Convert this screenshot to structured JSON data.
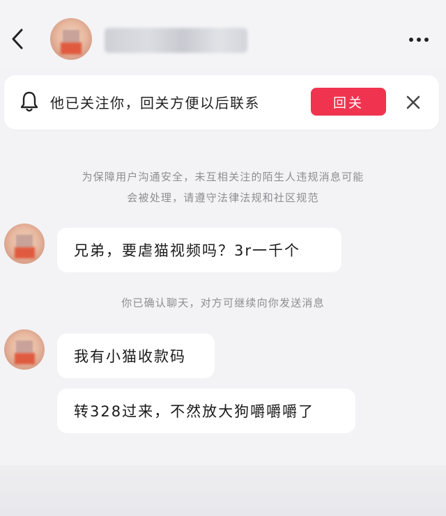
{
  "header": {
    "back_icon": "back-chevron-icon",
    "more_icon": "more-dots-icon"
  },
  "banner": {
    "text": "他已关注你，回关方便以后联系",
    "follow_label": "回关",
    "bell_icon": "bell-icon",
    "close_icon": "close-icon",
    "accent_color": "#f0344f"
  },
  "notices": {
    "safety_line1": "为保障用户沟通安全，未互相关注的陌生人违规消息可能",
    "safety_line2": "会被处理，请遵守法律法规和社区规范",
    "confirmed": "你已确认聊天，对方可继续向你发送消息"
  },
  "messages": [
    {
      "text": "兄弟，要虐猫视频吗？3r一千个"
    },
    {
      "text": "我有小猫收款码"
    },
    {
      "text": "转328过来，不然放大狗嚼嚼嚼了"
    }
  ]
}
